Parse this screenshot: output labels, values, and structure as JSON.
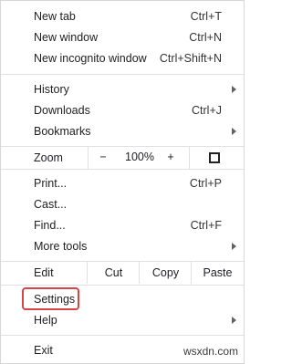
{
  "menu": {
    "new_tab": {
      "label": "New tab",
      "shortcut": "Ctrl+T"
    },
    "new_window": {
      "label": "New window",
      "shortcut": "Ctrl+N"
    },
    "new_incognito": {
      "label": "New incognito window",
      "shortcut": "Ctrl+Shift+N"
    },
    "history": {
      "label": "History"
    },
    "downloads": {
      "label": "Downloads",
      "shortcut": "Ctrl+J"
    },
    "bookmarks": {
      "label": "Bookmarks"
    },
    "zoom": {
      "label": "Zoom",
      "minus": "−",
      "value": "100%",
      "plus": "+",
      "fullscreen_icon": "fullscreen-icon"
    },
    "print": {
      "label": "Print...",
      "shortcut": "Ctrl+P"
    },
    "cast": {
      "label": "Cast..."
    },
    "find": {
      "label": "Find...",
      "shortcut": "Ctrl+F"
    },
    "more_tools": {
      "label": "More tools"
    },
    "edit": {
      "label": "Edit",
      "cut": "Cut",
      "copy": "Copy",
      "paste": "Paste"
    },
    "settings": {
      "label": "Settings"
    },
    "help": {
      "label": "Help"
    },
    "exit": {
      "label": "Exit"
    }
  },
  "highlight_color": "#d64545",
  "watermark": "wsxdn.com"
}
